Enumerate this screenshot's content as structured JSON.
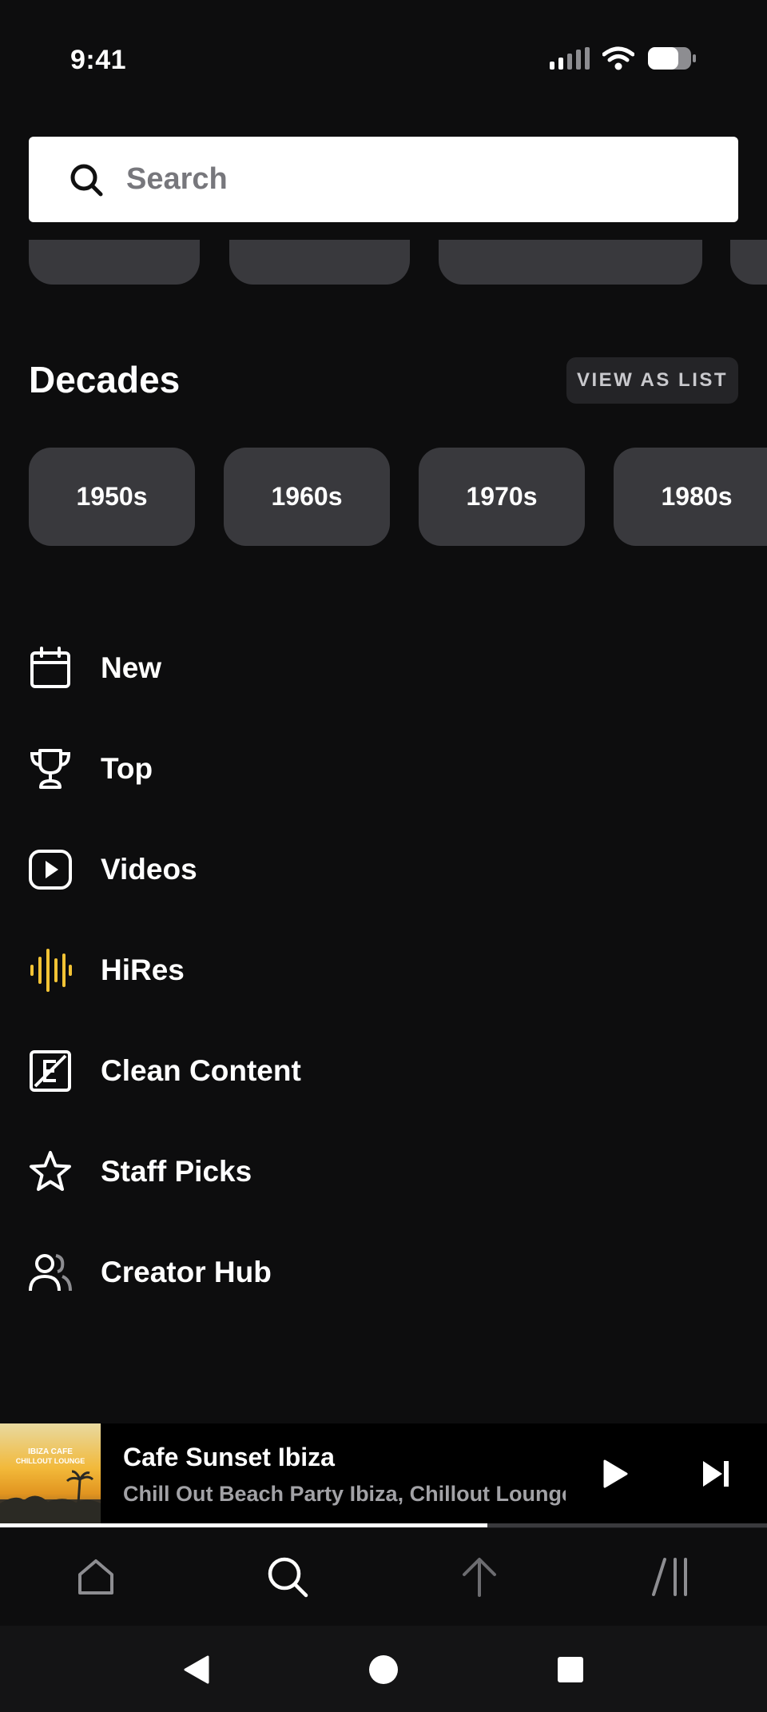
{
  "status_bar": {
    "time": "9:41"
  },
  "search": {
    "placeholder": "Search"
  },
  "decades": {
    "title": "Decades",
    "view_as_list": "VIEW AS LIST",
    "items": [
      "1950s",
      "1960s",
      "1970s",
      "1980s"
    ]
  },
  "menu": {
    "items": [
      {
        "label": "New",
        "icon": "calendar-icon"
      },
      {
        "label": "Top",
        "icon": "trophy-icon"
      },
      {
        "label": "Videos",
        "icon": "video-play-icon"
      },
      {
        "label": "HiRes",
        "icon": "waveform-icon"
      },
      {
        "label": "Clean Content",
        "icon": "explicit-icon"
      },
      {
        "label": "Staff Picks",
        "icon": "star-icon"
      },
      {
        "label": "Creator Hub",
        "icon": "people-icon"
      }
    ]
  },
  "now_playing": {
    "title": "Cafe Sunset Ibiza",
    "artist": "Chill Out Beach Party Ibiza, Chillout Lounge",
    "album_art_text": "IBIZA CAFE CHILLOUT LOUNGE",
    "progress": 0.635
  },
  "bottom_nav": {
    "items": [
      "home-icon",
      "search-icon",
      "upload-icon",
      "library-icon"
    ],
    "active": "search-icon"
  },
  "colors": {
    "background": "#0d0d0e",
    "chip": "#39393d",
    "hires_accent": "#f2c335",
    "text_primary": "#ffffff"
  }
}
